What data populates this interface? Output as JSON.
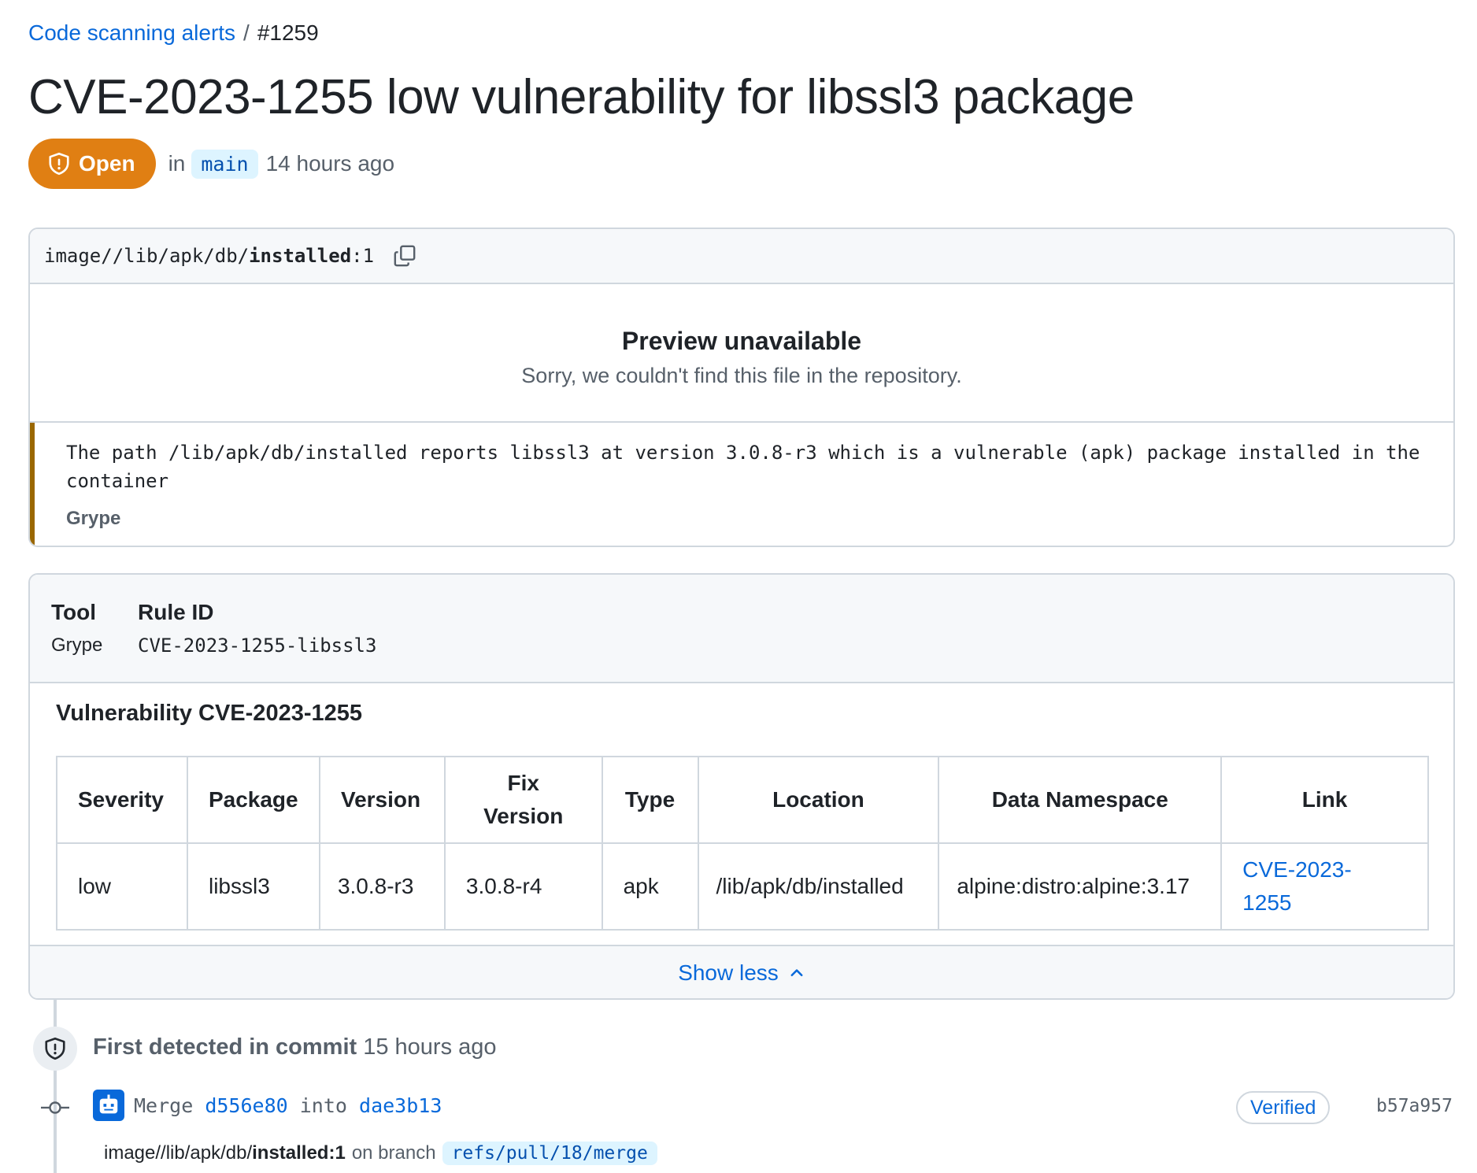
{
  "breadcrumb": {
    "parent": "Code scanning alerts",
    "separator": "/",
    "current": "#1259"
  },
  "title": "CVE-2023-1255 low vulnerability for libssl3 package",
  "status": {
    "label": "Open",
    "color": "#e07f13",
    "in": "in",
    "branch": "main",
    "time": "14 hours ago"
  },
  "code": {
    "path_prefix": "image//lib/apk/db/",
    "path_file": "installed",
    "path_line": ":1",
    "preview_title": "Preview unavailable",
    "preview_sub": "Sorry, we couldn't find this file in the repository.",
    "message": "The path /lib/apk/db/installed reports libssl3 at version 3.0.8-r3 which is a vulnerable (apk) package installed in the container",
    "tool": "Grype"
  },
  "info": {
    "tool_label": "Tool",
    "tool_value": "Grype",
    "rule_label": "Rule ID",
    "rule_value": "CVE-2023-1255-libssl3",
    "vuln_heading": "Vulnerability CVE-2023-1255",
    "table": {
      "headers": [
        "Severity",
        "Package",
        "Version",
        "Fix Version",
        "Type",
        "Location",
        "Data Namespace",
        "Link"
      ],
      "row": [
        "low",
        "libssl3",
        "3.0.8-r3",
        "3.0.8-r4",
        "apk",
        "/lib/apk/db/installed",
        "alpine:distro:alpine:3.17",
        "CVE-2023-1255"
      ]
    },
    "show_less": "Show less"
  },
  "timeline": {
    "detected_bold": "First detected in commit",
    "detected_time": "15 hours ago",
    "commit_word": "Merge",
    "commit_from": "d556e80",
    "commit_into": "into",
    "commit_to": "dae3b13",
    "verified": "Verified",
    "sha": "b57a957",
    "path_prefix": "image//lib/apk/db/",
    "path_file": "installed:1",
    "on_branch": "on branch",
    "ref": "refs/pull/18/merge"
  }
}
